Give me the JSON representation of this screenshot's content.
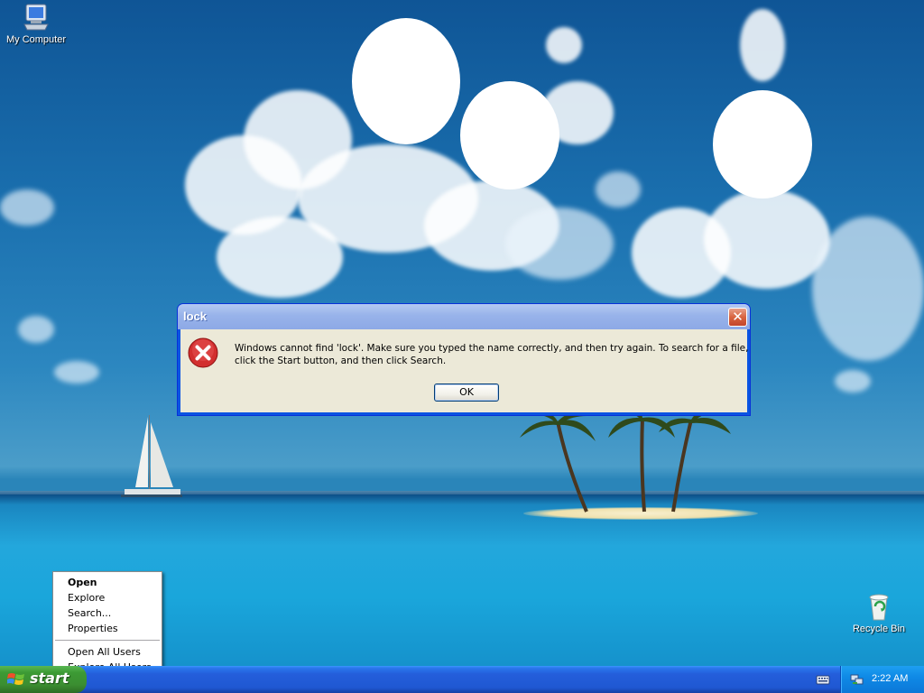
{
  "desktop": {
    "icons": [
      {
        "label": "My Computer",
        "icon": "my-computer-icon"
      },
      {
        "label": "Recycle Bin",
        "icon": "recycle-bin-icon"
      }
    ]
  },
  "dialog": {
    "title": "lock",
    "close_label": "✕",
    "message": "Windows cannot find 'lock'. Make sure you typed the name correctly, and then try again. To search for a file, click the Start button, and then click Search.",
    "icon": "error-icon",
    "ok_label": "OK"
  },
  "context_menu": {
    "items": [
      {
        "label": "Open",
        "default": true
      },
      {
        "label": "Explore"
      },
      {
        "label": "Search..."
      },
      {
        "label": "Properties"
      },
      {
        "label": "Open All Users"
      },
      {
        "label": "Explore All Users"
      }
    ]
  },
  "taskbar": {
    "start_label": "start",
    "clock": "2:22 AM",
    "tray_icons": [
      "keyboard-icon",
      "network-icon"
    ]
  },
  "colors": {
    "taskbar": "#245edb",
    "start_button": "#3c9a34",
    "dialog_title": "#98b3ea",
    "dialog_body": "#ece9d8",
    "error_red": "#d22f2f"
  }
}
